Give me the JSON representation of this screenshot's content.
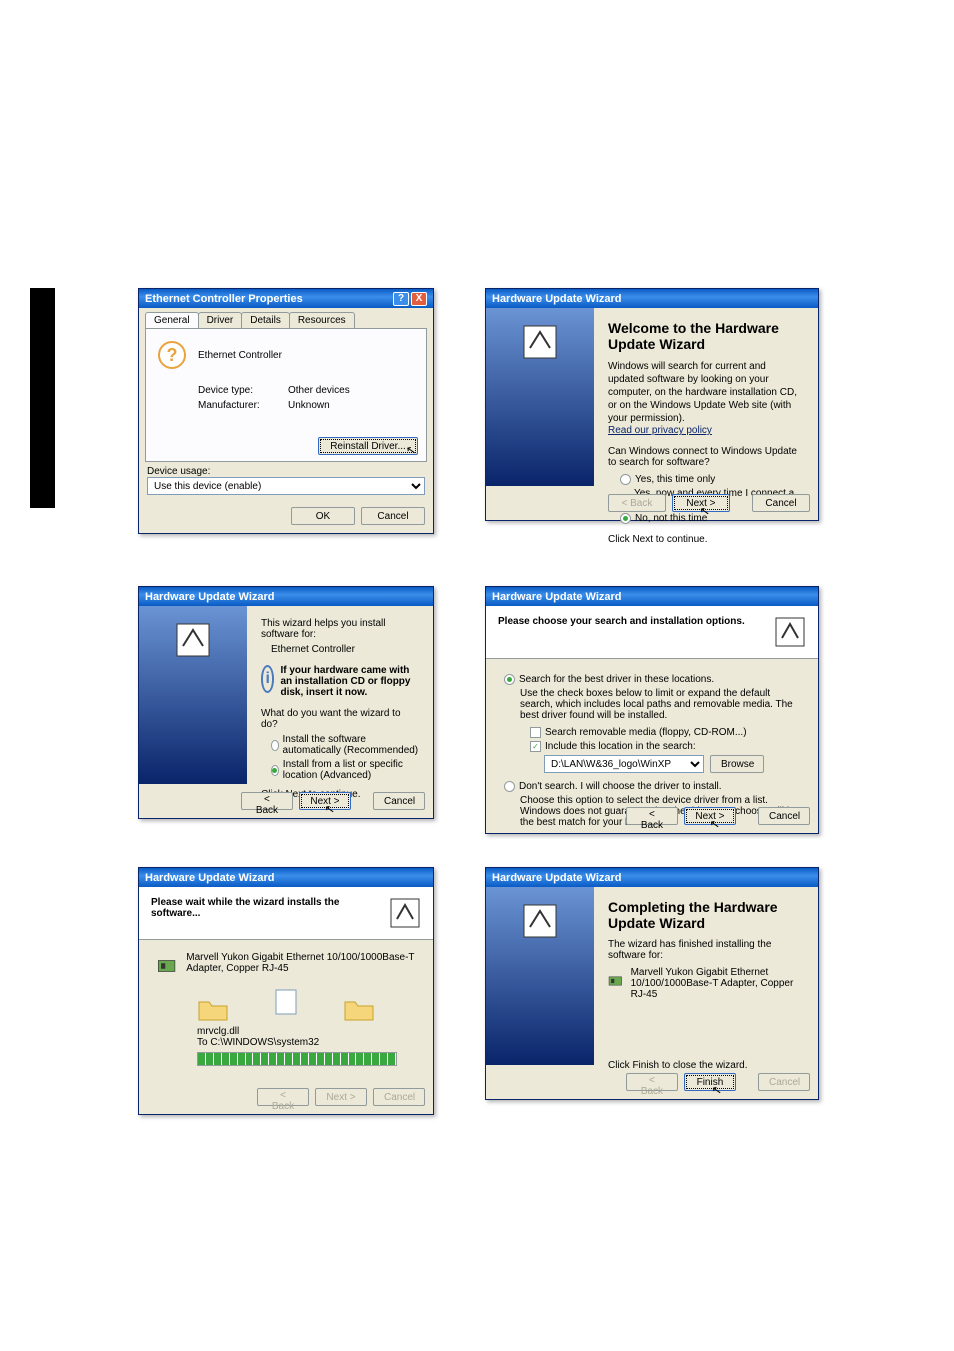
{
  "side_tab": {},
  "properties": {
    "title": "Ethernet Controller Properties",
    "tabs": [
      "General",
      "Driver",
      "Details",
      "Resources"
    ],
    "device_name": "Ethernet Controller",
    "device_type_label": "Device type:",
    "device_type_value": "Other devices",
    "manufacturer_label": "Manufacturer:",
    "manufacturer_value": "Unknown",
    "reinstall_btn": "Reinstall Driver...",
    "usage_label": "Device usage:",
    "usage_value": "Use this device (enable)",
    "ok": "OK",
    "cancel": "Cancel"
  },
  "wizard_welcome": {
    "title": "Hardware Update Wizard",
    "heading": "Welcome to the Hardware Update Wizard",
    "desc": "Windows will search for current and updated software by looking on your computer, on the hardware installation CD, or on the Windows Update Web site (with your permission).",
    "privacy": "Read our privacy policy",
    "question": "Can Windows connect to Windows Update to search for software?",
    "opt1": "Yes, this time only",
    "opt2": "Yes, now and every time I connect a device",
    "opt3": "No, not this time",
    "continue": "Click Next to continue.",
    "back": "< Back",
    "next": "Next >",
    "cancel": "Cancel"
  },
  "wizard_install_method": {
    "title": "Hardware Update Wizard",
    "helps": "This wizard helps you install software for:",
    "device": "Ethernet Controller",
    "cd_hint": "If your hardware came with an installation CD or floppy disk, insert it now.",
    "question": "What do you want the wizard to do?",
    "opt1": "Install the software automatically (Recommended)",
    "opt2": "Install from a list or specific location (Advanced)",
    "continue": "Click Next to continue.",
    "back": "< Back",
    "next": "Next >",
    "cancel": "Cancel"
  },
  "wizard_search_opts": {
    "title": "Hardware Update Wizard",
    "header": "Please choose your search and installation options.",
    "opt_search": "Search for the best driver in these locations.",
    "search_desc": "Use the check boxes below to limit or expand the default search, which includes local paths and removable media. The best driver found will be installed.",
    "chk_removable": "Search removable media (floppy, CD-ROM...)",
    "chk_include": "Include this location in the search:",
    "path": "D:\\LAN\\W&36_logo\\WinXP",
    "browse": "Browse",
    "opt_dont": "Don't search. I will choose the driver to install.",
    "dont_desc": "Choose this option to select the device driver from a list. Windows does not guarantee that the driver you choose will be the best match for your hardware.",
    "back": "< Back",
    "next": "Next >",
    "cancel": "Cancel"
  },
  "wizard_installing": {
    "title": "Hardware Update Wizard",
    "header": "Please wait while the wizard installs the software...",
    "device": "Marvell Yukon Gigabit Ethernet 10/100/1000Base-T Adapter, Copper RJ-45",
    "file": "mrvclg.dll",
    "dest": "To C:\\WINDOWS\\system32",
    "back": "< Back",
    "next": "Next >",
    "cancel": "Cancel"
  },
  "wizard_complete": {
    "title": "Hardware Update Wizard",
    "heading": "Completing the Hardware Update Wizard",
    "done": "The wizard has finished installing the software for:",
    "device": "Marvell Yukon Gigabit Ethernet 10/100/1000Base-T Adapter, Copper RJ-45",
    "continue": "Click Finish to close the wizard.",
    "back": "< Back",
    "finish": "Finish",
    "cancel": "Cancel"
  }
}
